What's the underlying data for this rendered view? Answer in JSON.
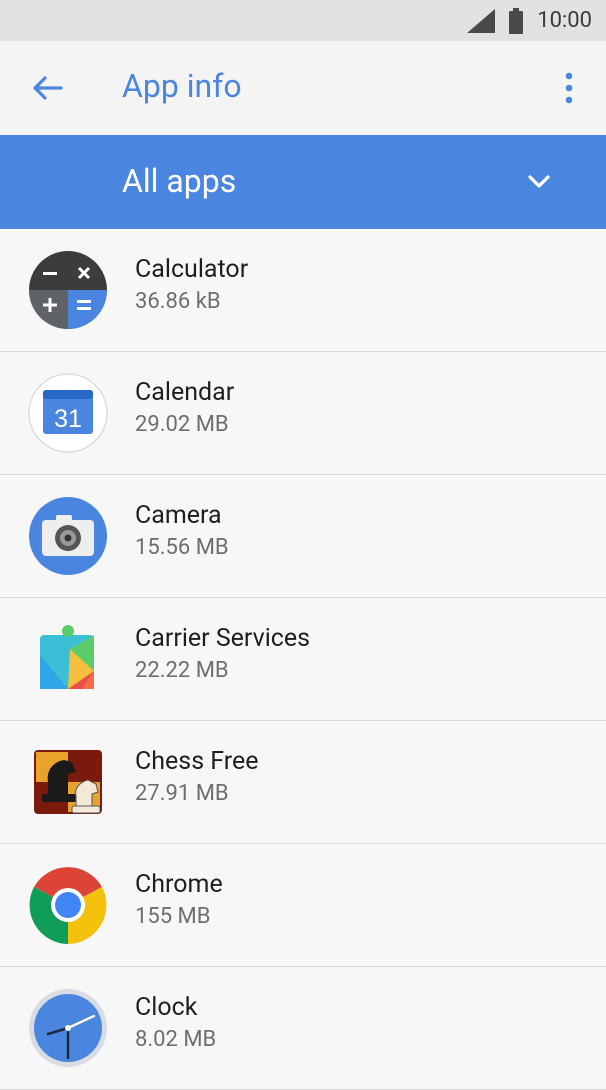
{
  "status": {
    "time": "10:00"
  },
  "header": {
    "title": "App info"
  },
  "filter": {
    "label": "All apps"
  },
  "apps": [
    {
      "name": "Calculator",
      "size": "36.86 kB",
      "icon": "calculator-icon"
    },
    {
      "name": "Calendar",
      "size": "29.02 MB",
      "icon": "calendar-icon",
      "icon_text": "31"
    },
    {
      "name": "Camera",
      "size": "15.56 MB",
      "icon": "camera-icon"
    },
    {
      "name": "Carrier Services",
      "size": "22.22 MB",
      "icon": "carrier-services-icon"
    },
    {
      "name": "Chess Free",
      "size": "27.91 MB",
      "icon": "chess-icon"
    },
    {
      "name": "Chrome",
      "size": "155 MB",
      "icon": "chrome-icon"
    },
    {
      "name": "Clock",
      "size": "8.02 MB",
      "icon": "clock-icon"
    }
  ],
  "colors": {
    "accent": "#4a86e0",
    "app_bar": "#f4f4f4",
    "status_bar": "#e2e2e2"
  }
}
